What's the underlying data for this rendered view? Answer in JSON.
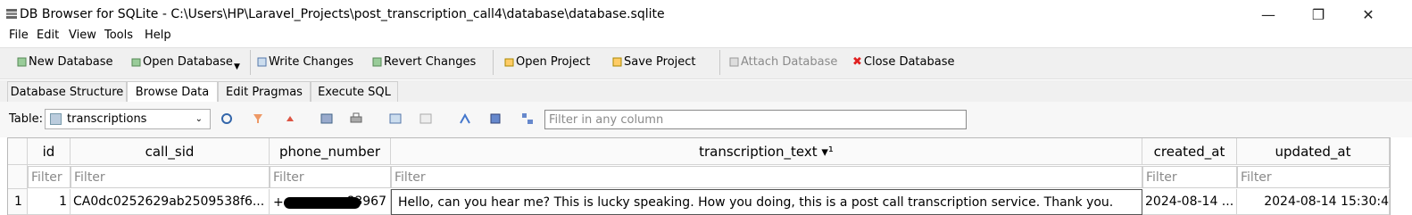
{
  "window": {
    "title": "DB Browser for SQLite - C:\\Users\\HP\\Laravel_Projects\\post_transcription_call4\\database\\database.sqlite",
    "minimize": "—",
    "restore": "❐",
    "close": "✕"
  },
  "menu": [
    "File",
    "Edit",
    "View",
    "Tools",
    "Help"
  ],
  "toolbar": {
    "new_database": "New Database",
    "open_database": "Open Database",
    "write_changes": "Write Changes",
    "revert_changes": "Revert Changes",
    "open_project": "Open Project",
    "save_project": "Save Project",
    "attach_database": "Attach Database",
    "close_database": "Close Database"
  },
  "tabs": [
    "Database Structure",
    "Browse Data",
    "Edit Pragmas",
    "Execute SQL"
  ],
  "active_tab": "Browse Data",
  "browse": {
    "table_label": "Table:",
    "table_value": "transcriptions",
    "filter_placeholder": "Filter in any column"
  },
  "grid": {
    "columns": [
      "id",
      "call_sid",
      "phone_number",
      "transcription_text ▾¹",
      "created_at",
      "updated_at"
    ],
    "filter_placeholder": "Filter",
    "rows": [
      {
        "row_number": "1",
        "id": "1",
        "call_sid": "CA0dc0252629ab2509538f6...",
        "phone_number": "83967",
        "transcription_text": "Hello, can you hear me? This is lucky speaking. How you doing, this is a post call transcription service. Thank you.",
        "created_at": "2024-08-14 ...",
        "updated_at": "2024-08-14 15:30:4"
      }
    ]
  },
  "colors": {
    "toolbar_bg": "#f0f0f0",
    "close_db_icon": "#e02020",
    "grid_border": "#d4d4d4"
  }
}
